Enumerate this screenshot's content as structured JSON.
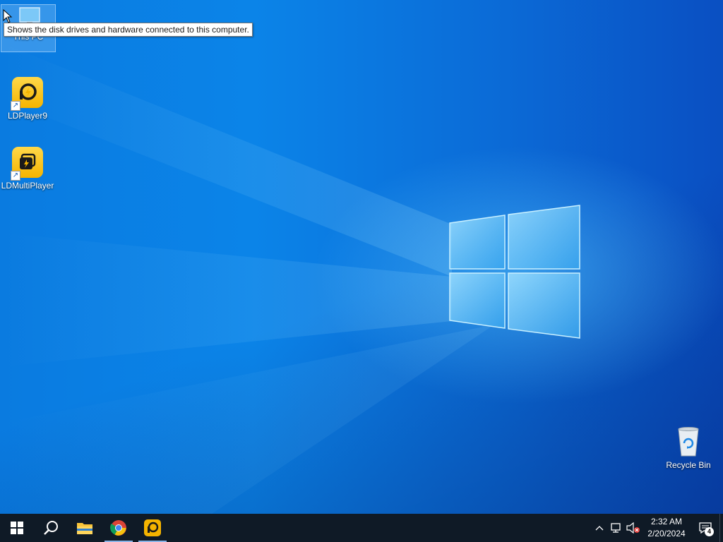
{
  "desktop": {
    "icons": [
      {
        "label": "This PC",
        "icon": "this-pc-icon",
        "selected": true
      },
      {
        "label": "LDPlayer9",
        "icon": "ldplayer-icon",
        "shortcut": true
      },
      {
        "label": "LDMultiPlayer",
        "icon": "ldmultiplayer-icon",
        "shortcut": true
      },
      {
        "label": "Recycle Bin",
        "icon": "recycle-bin-icon"
      }
    ],
    "tooltip": "Shows the disk drives and hardware connected to this computer."
  },
  "taskbar": {
    "pinned": [
      {
        "name": "start",
        "icon": "windows-logo-icon"
      },
      {
        "name": "search",
        "icon": "search-icon"
      },
      {
        "name": "file-explorer",
        "icon": "folder-icon"
      },
      {
        "name": "chrome",
        "icon": "chrome-icon",
        "active": true
      },
      {
        "name": "ldplayer",
        "icon": "ldplayer-icon",
        "active": true
      }
    ],
    "tray": {
      "time": "2:32 AM",
      "date": "2/20/2024",
      "notification_count": "4"
    }
  },
  "colors": {
    "desktop_blue": "#0b84e8",
    "taskbar": "#0f1a26",
    "ld_yellow": "#f5b400"
  }
}
